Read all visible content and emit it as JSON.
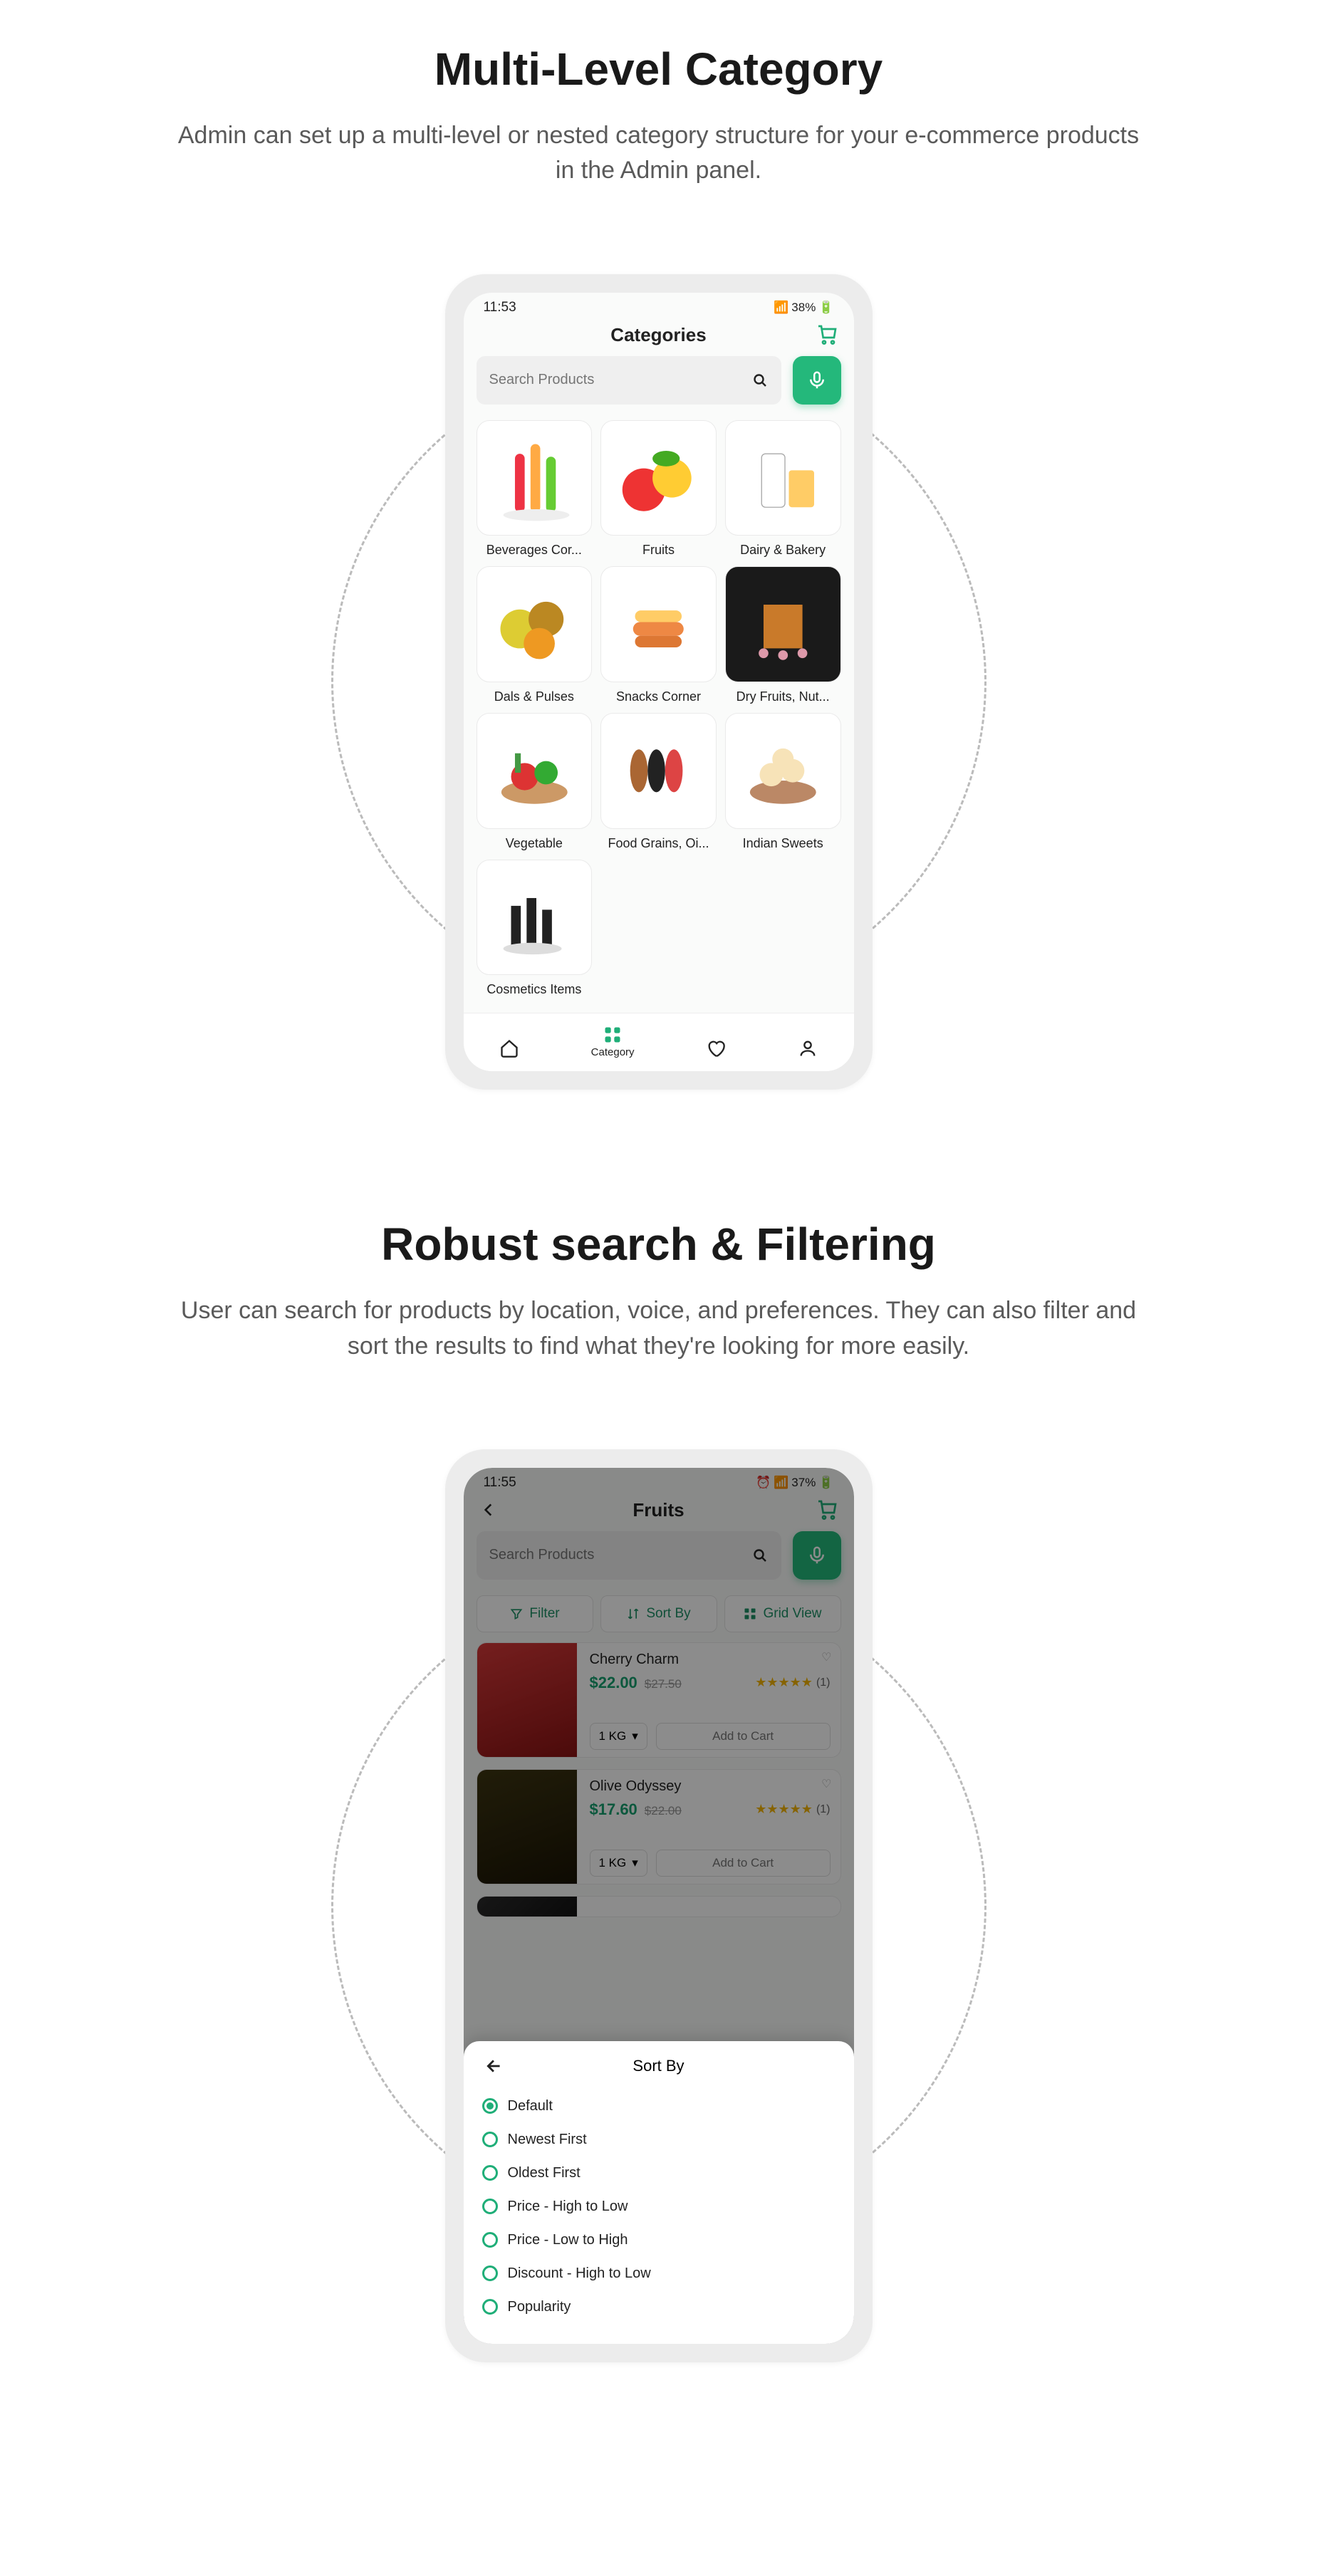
{
  "section1": {
    "title": "Multi-Level Category",
    "desc": "Admin can set up a multi-level or nested category structure for your e-commerce products in the Admin panel."
  },
  "section2": {
    "title": "Robust search & Filtering",
    "desc": "User can search for products by location, voice, and preferences. They can also filter and sort the results to find what they're looking for more easily."
  },
  "phone1": {
    "status_time": "11:53",
    "status_right": "38%",
    "header_title": "Categories",
    "search_placeholder": "Search Products",
    "nav_category": "Category",
    "categories": [
      {
        "label": "Beverages Cor..."
      },
      {
        "label": "Fruits"
      },
      {
        "label": "Dairy & Bakery"
      },
      {
        "label": "Dals & Pulses"
      },
      {
        "label": "Snacks Corner"
      },
      {
        "label": "Dry Fruits, Nut..."
      },
      {
        "label": "Vegetable"
      },
      {
        "label": "Food Grains, Oi..."
      },
      {
        "label": "Indian Sweets"
      },
      {
        "label": "Cosmetics Items"
      }
    ]
  },
  "phone2": {
    "status_time": "11:55",
    "status_right": "37%",
    "header_title": "Fruits",
    "search_placeholder": "Search Products",
    "filter_label": "Filter",
    "sort_label": "Sort By",
    "grid_label": "Grid View",
    "products": [
      {
        "name": "Cherry Charm",
        "price": "$22.00",
        "old": "$27.50",
        "rating_count": "(1)",
        "weight": "1 KG",
        "add": "Add to Cart"
      },
      {
        "name": "Olive Odyssey",
        "price": "$17.60",
        "old": "$22.00",
        "rating_count": "(1)",
        "weight": "1 KG",
        "add": "Add to Cart"
      }
    ],
    "sheet_title": "Sort By",
    "sort_options": [
      {
        "label": "Default",
        "selected": true
      },
      {
        "label": "Newest First",
        "selected": false
      },
      {
        "label": "Oldest First",
        "selected": false
      },
      {
        "label": "Price - High to Low",
        "selected": false
      },
      {
        "label": "Price - Low to High",
        "selected": false
      },
      {
        "label": "Discount - High to Low",
        "selected": false
      },
      {
        "label": "Popularity",
        "selected": false
      }
    ]
  },
  "accent": "#1fae78"
}
